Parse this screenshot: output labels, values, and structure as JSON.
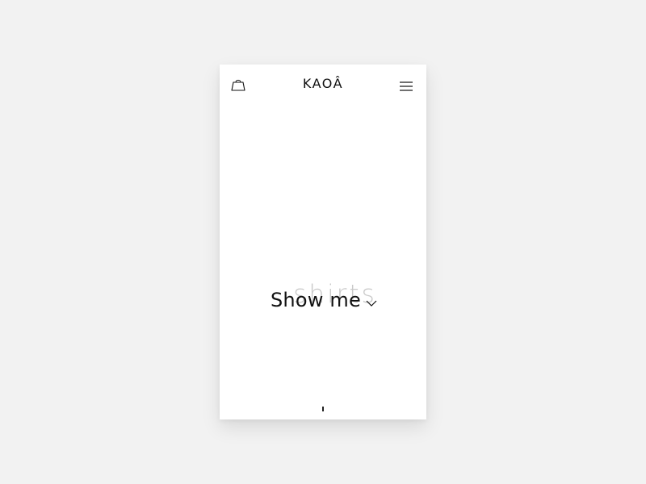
{
  "brand": {
    "name": "KAOÂ"
  },
  "header": {
    "cart_icon": "shopping-bag-icon",
    "menu_icon": "hamburger-menu-icon"
  },
  "hero": {
    "prompt": "Show me",
    "category": "shirts",
    "dropdown_icon": "chevron-down-icon"
  },
  "colors": {
    "background": "#f2f2f2",
    "card": "#ffffff",
    "text": "#111111",
    "ghost_text": "#c9c9c9"
  }
}
